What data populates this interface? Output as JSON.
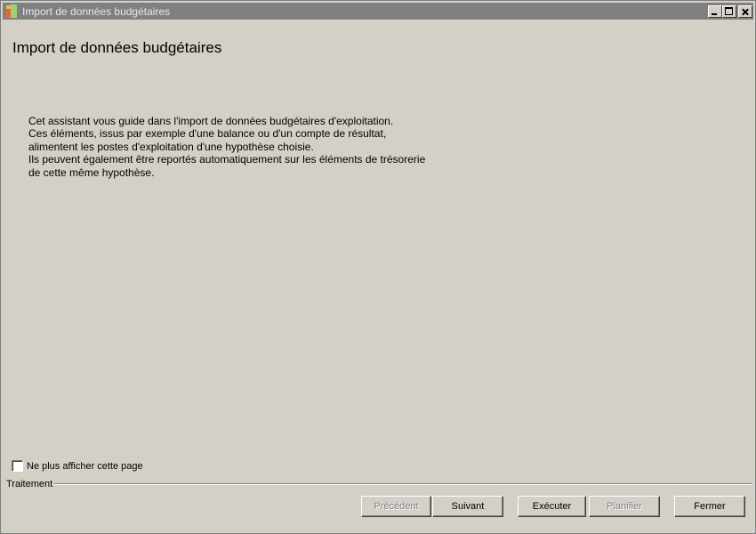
{
  "window": {
    "title": "Import de données budgétaires"
  },
  "page": {
    "title": "Import de données budgétaires"
  },
  "intro": {
    "lines": [
      "Cet assistant vous guide dans l'import de données budgétaires d'exploitation.",
      "Ces éléments, issus par exemple d'une balance ou d'un compte de résultat,",
      "alimentent les postes d'exploitation d'une hypothèse choisie.",
      "Ils peuvent également être reportés automatiquement sur les éléments de trésorerie",
      "de cette même hypothèse."
    ]
  },
  "options": {
    "hide_page_label": "Ne plus afficher cette page",
    "hide_page_checked": false
  },
  "group": {
    "label": "Traitement"
  },
  "buttons": {
    "previous": "Précédent",
    "next": "Suivant",
    "execute": "Exécuter",
    "schedule": "Planifier",
    "close": "Fermer"
  },
  "colors": {
    "titlebar": "#808080",
    "background": "#d4d0c8"
  }
}
